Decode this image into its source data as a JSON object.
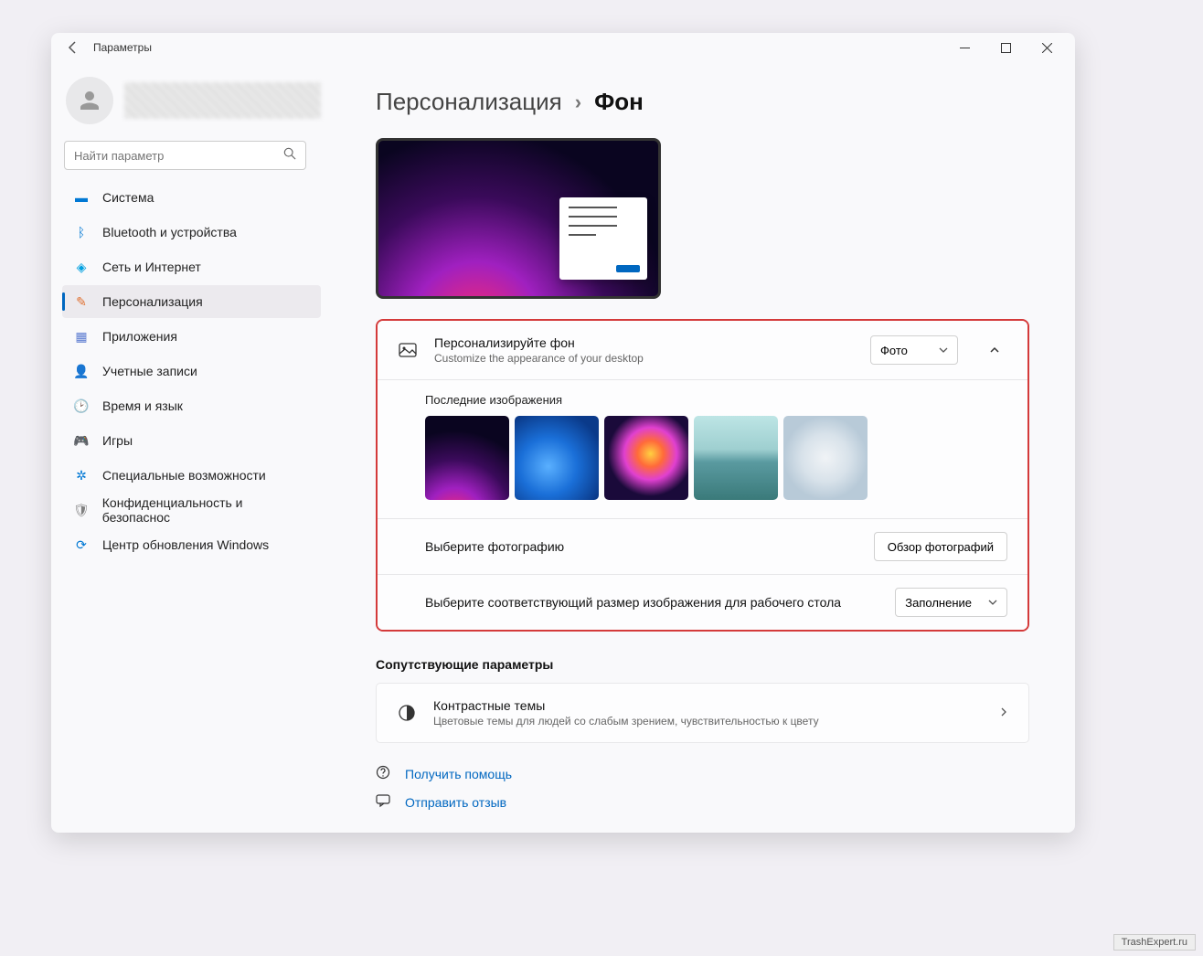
{
  "app_title": "Параметры",
  "search_placeholder": "Найти параметр",
  "sidebar": {
    "items": [
      {
        "label": "Система"
      },
      {
        "label": "Bluetooth и устройства"
      },
      {
        "label": "Сеть и Интернет"
      },
      {
        "label": "Персонализация"
      },
      {
        "label": "Приложения"
      },
      {
        "label": "Учетные записи"
      },
      {
        "label": "Время и язык"
      },
      {
        "label": "Игры"
      },
      {
        "label": "Специальные возможности"
      },
      {
        "label": "Конфиденциальность и безопаснос"
      },
      {
        "label": "Центр обновления Windows"
      }
    ]
  },
  "breadcrumb": {
    "parent": "Персонализация",
    "current": "Фон"
  },
  "personalize": {
    "title": "Персонализируйте фон",
    "subtitle": "Customize the appearance of your desktop",
    "dropdown_value": "Фото"
  },
  "recent_images_label": "Последние изображения",
  "choose_photo": {
    "label": "Выберите фотографию",
    "button": "Обзор фотографий"
  },
  "fit": {
    "label": "Выберите соответствующий размер изображения для рабочего стола",
    "value": "Заполнение"
  },
  "related_title": "Сопутствующие параметры",
  "contrast": {
    "title": "Контрастные темы",
    "subtitle": "Цветовые темы для людей со слабым зрением, чувствительностью к цвету"
  },
  "help_link": "Получить помощь",
  "feedback_link": "Отправить отзыв",
  "watermark": "TrashExpert.ru"
}
